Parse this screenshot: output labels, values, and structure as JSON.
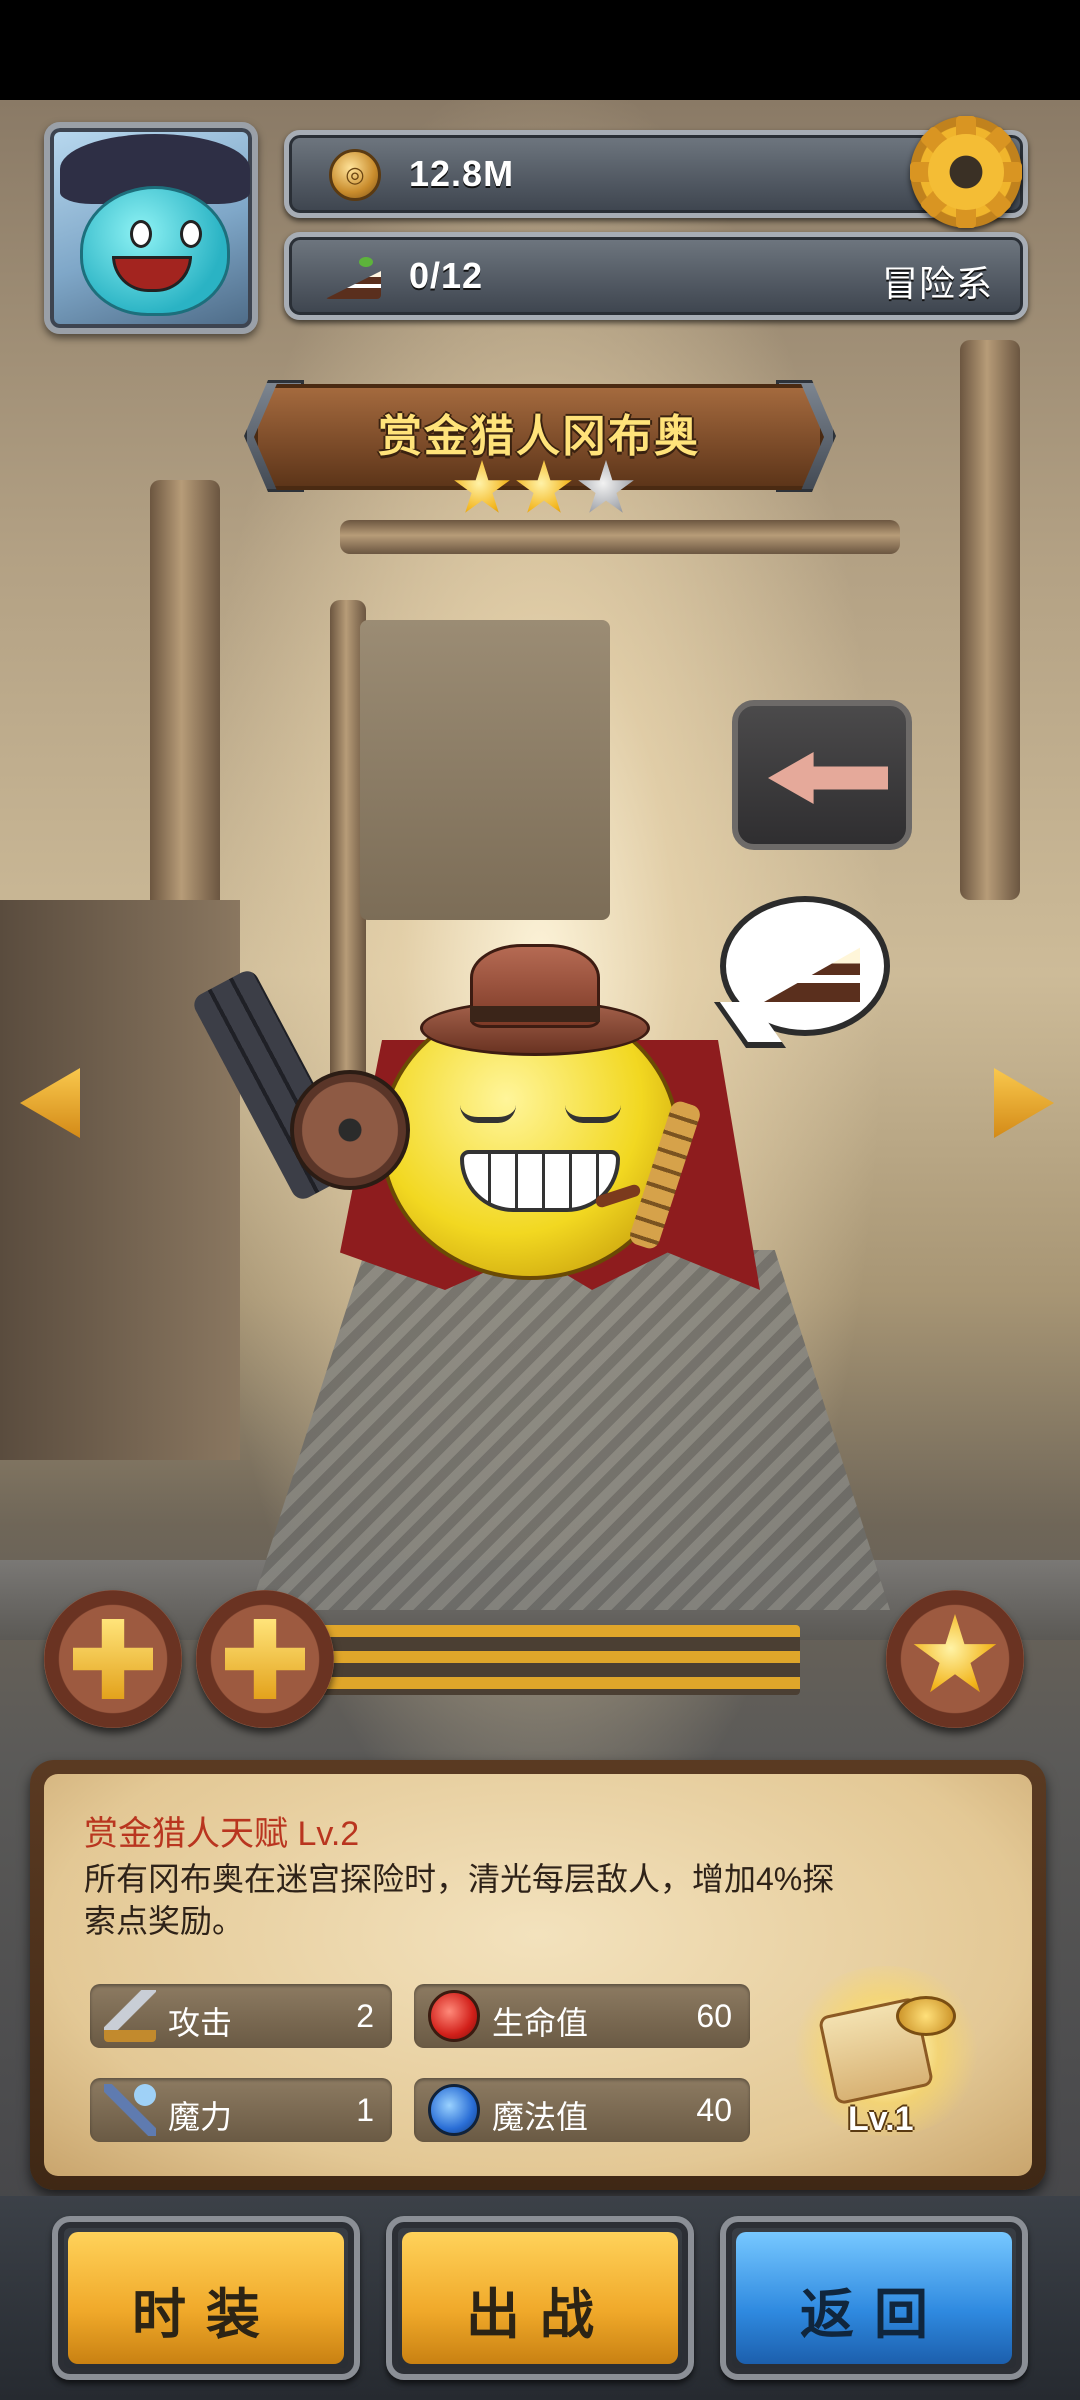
{
  "header": {
    "coins": "12.8M",
    "cake_count": "0/12",
    "category": "冒险系"
  },
  "hero": {
    "name": "赏金猎人冈布奥",
    "stars_filled": 2,
    "stars_total": 3
  },
  "talent": {
    "title": "赏金猎人天赋 Lv.2",
    "description": "所有冈布奥在迷宫探险时，清光每层敌人，增加4%探索点奖励。"
  },
  "stats": {
    "attack": {
      "label": "攻击",
      "value": "2"
    },
    "hp": {
      "label": "生命值",
      "value": "60"
    },
    "magic": {
      "label": "魔力",
      "value": "1"
    },
    "mp": {
      "label": "魔法值",
      "value": "40"
    }
  },
  "treasure": {
    "level": "Lv.1"
  },
  "buttons": {
    "costume": "时装",
    "battle": "出战",
    "back": "返回"
  },
  "icons": {
    "settings": "gear-icon",
    "coin": "coin-icon",
    "cake": "cake-icon",
    "plus": "plus-icon",
    "star": "star-icon"
  },
  "colors": {
    "accent_gold": "#f0a92a",
    "accent_blue": "#2f8ae0",
    "talent_title": "#b9351f"
  }
}
